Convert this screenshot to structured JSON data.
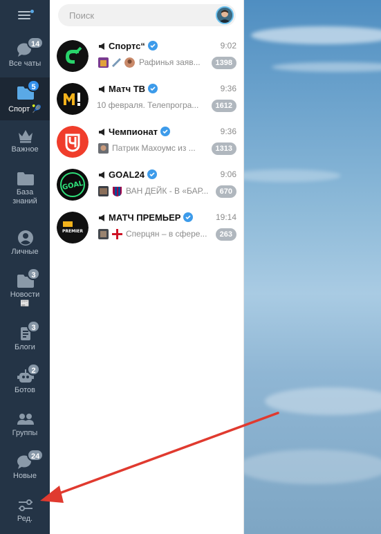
{
  "sidebar": {
    "folders": [
      {
        "label": "Все чаты",
        "badge": "14",
        "icon": "chat-bubbles-icon",
        "extra": ""
      },
      {
        "label": "Спорт",
        "badge": "5",
        "icon": "folder-icon",
        "extra": "🎾"
      },
      {
        "label": "Важное",
        "badge": "",
        "icon": "crown-icon",
        "extra": ""
      },
      {
        "label": "База\nзнаний",
        "badge": "",
        "icon": "folder-icon",
        "extra": ""
      },
      {
        "label": "Личные",
        "badge": "",
        "icon": "person-icon",
        "extra": ""
      },
      {
        "label": "Новости",
        "badge": "3",
        "icon": "folder-icon",
        "extra": "📰"
      },
      {
        "label": "Блоги",
        "badge": "3",
        "icon": "document-icon",
        "extra": ""
      },
      {
        "label": "Ботов",
        "badge": "2",
        "icon": "robot-icon",
        "extra": ""
      },
      {
        "label": "Группы",
        "badge": "",
        "icon": "people-icon",
        "extra": ""
      },
      {
        "label": "Новые",
        "badge": "24",
        "icon": "chat-bubbles-icon",
        "extra": ""
      },
      {
        "label": "Ред.",
        "badge": "",
        "icon": "sliders-icon",
        "extra": ""
      }
    ],
    "active_index": 1
  },
  "search": {
    "placeholder": "Поиск"
  },
  "chats": [
    {
      "name": "Спортс“",
      "time": "9:02",
      "preview": "Рафинья заяв...",
      "count": "1398",
      "avatar_color": "#111111",
      "accent": "#29d36a"
    },
    {
      "name": "Матч ТВ",
      "time": "9:36",
      "preview": "10 февраля. Телепрогра...",
      "count": "1612",
      "avatar_color": "#0f0f0f",
      "accent": "#f3b21b"
    },
    {
      "name": "Чемпионат",
      "time": "9:36",
      "preview": "Патрик Махоумс из ...",
      "count": "1313",
      "avatar_color": "#f03d2b",
      "accent": "#ffffff"
    },
    {
      "name": "GOAL24",
      "time": "9:06",
      "preview": "ВАН ДЕЙК - В «БАР...",
      "count": "670",
      "avatar_color": "#0c0c0c",
      "accent": "#2ee07a"
    },
    {
      "name": "МАТЧ ПРЕМЬЕР",
      "time": "19:14",
      "preview": "Сперцян – в сфере...",
      "count": "263",
      "avatar_color": "#111111",
      "accent": "#f3b21b"
    }
  ],
  "colors": {
    "sidebar_bg": "#243446",
    "active_folder_bg": "#1c2734",
    "active_badge": "#3390ec",
    "muted_badge": "#b0b7be",
    "annotation_arrow": "#e03a2f"
  }
}
